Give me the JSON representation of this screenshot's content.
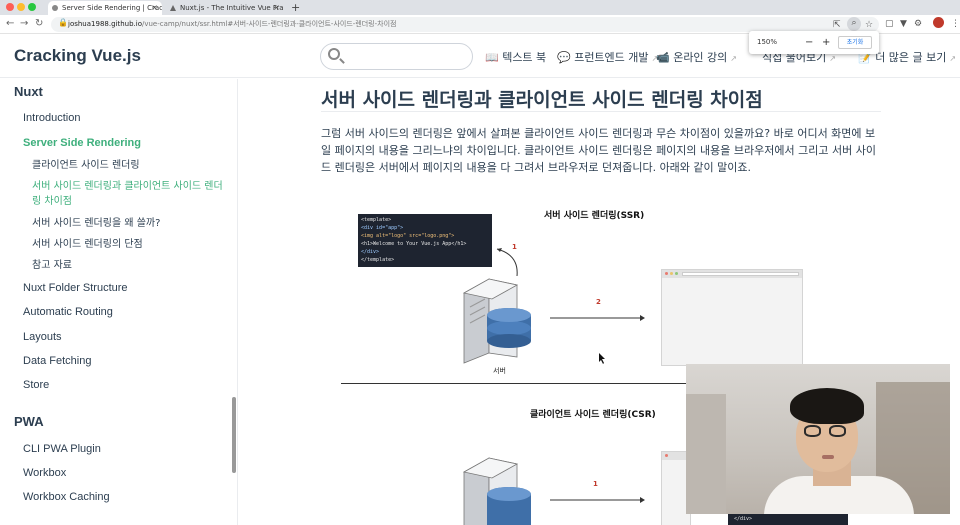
{
  "browser": {
    "tabs": [
      {
        "title": "Server Side Rendering | Crackin",
        "active": true
      },
      {
        "title": "Nuxt.js - The Intuitive Vue Fram",
        "active": false
      }
    ],
    "url_host": "joshua1988.github.io",
    "url_path": "/vue-camp/nuxt/ssr.html#서버-사이드-렌더링과-클라이언트-사이드-렌더링-차이점",
    "zoom": {
      "level": "150%",
      "minus": "−",
      "plus": "+",
      "reset_label": "초기화"
    }
  },
  "site": {
    "brand": "Cracking Vue.js",
    "search_placeholder": "",
    "nav": [
      {
        "label": "📖 텍스트 북",
        "external": false
      },
      {
        "label": "💬 프런트엔드 개발",
        "external": true
      },
      {
        "label": "📹 온라인 강의",
        "external": true
      },
      {
        "label": "직접 물어보기",
        "external": true
      },
      {
        "label": "📝 더 많은 글 보기",
        "external": true
      }
    ]
  },
  "sidebar": {
    "groups": [
      {
        "title": "Nuxt",
        "items": [
          {
            "label": "Introduction",
            "active": false
          },
          {
            "label": "Server Side Rendering",
            "active": true,
            "children": [
              {
                "label": "클라이언트 사이드 렌더링",
                "active": false
              },
              {
                "label": "서버 사이드 렌더링과 클라이언트 사이드 렌더링 차이점",
                "active": true
              },
              {
                "label": "서버 사이드 렌더링을 왜 쓸까?",
                "active": false
              },
              {
                "label": "서버 사이드 렌더링의 단점",
                "active": false
              },
              {
                "label": "참고 자료",
                "active": false
              }
            ]
          },
          {
            "label": "Nuxt Folder Structure",
            "active": false
          },
          {
            "label": "Automatic Routing",
            "active": false
          },
          {
            "label": "Layouts",
            "active": false
          },
          {
            "label": "Data Fetching",
            "active": false
          },
          {
            "label": "Store",
            "active": false
          }
        ]
      },
      {
        "title": "PWA",
        "items": [
          {
            "label": "CLI PWA Plugin",
            "active": false
          },
          {
            "label": "Workbox",
            "active": false
          },
          {
            "label": "Workbox Caching",
            "active": false
          }
        ]
      }
    ]
  },
  "content": {
    "heading": "서버 사이드 렌더링과 클라이언트 사이드 렌더링 차이점",
    "paragraph": "그럼 서버 사이드의 렌더링은 앞에서 살펴본 클라이언트 사이드 렌더링과 무슨 차이점이 있을까요? 바로 어디서 화면에 보일 페이지의 내용을 그리느냐의 차이입니다. 클라이언트 사이드 렌더링은 페이지의 내용을 브라우저에서 그리고 서버 사이드 렌더링은 서버에서 페이지의 내용을 다 그려서 브라우저로 던져줍니다. 아래와 같이 말이죠.",
    "diagram": {
      "ssr_title": "서버 사이드 렌더링(SSR)",
      "csr_title": "클라이언트 사이드 렌더링(CSR)",
      "server_caption": "서버",
      "code_lines": [
        "<template>",
        "  <div id=\"app\">",
        "    <img alt=\"logo\" src=\"logo.png\">",
        "    <h1>Welcome to Your Vue.js App</h1>",
        "  </div>",
        "</template>"
      ],
      "code_tail": "</div>",
      "step_ssr_1": "1",
      "step_ssr_2": "2",
      "step_csr_1": "1"
    }
  },
  "colors": {
    "accent": "#3eaf7c",
    "text": "#2c3e50",
    "step": "#c0392b"
  }
}
